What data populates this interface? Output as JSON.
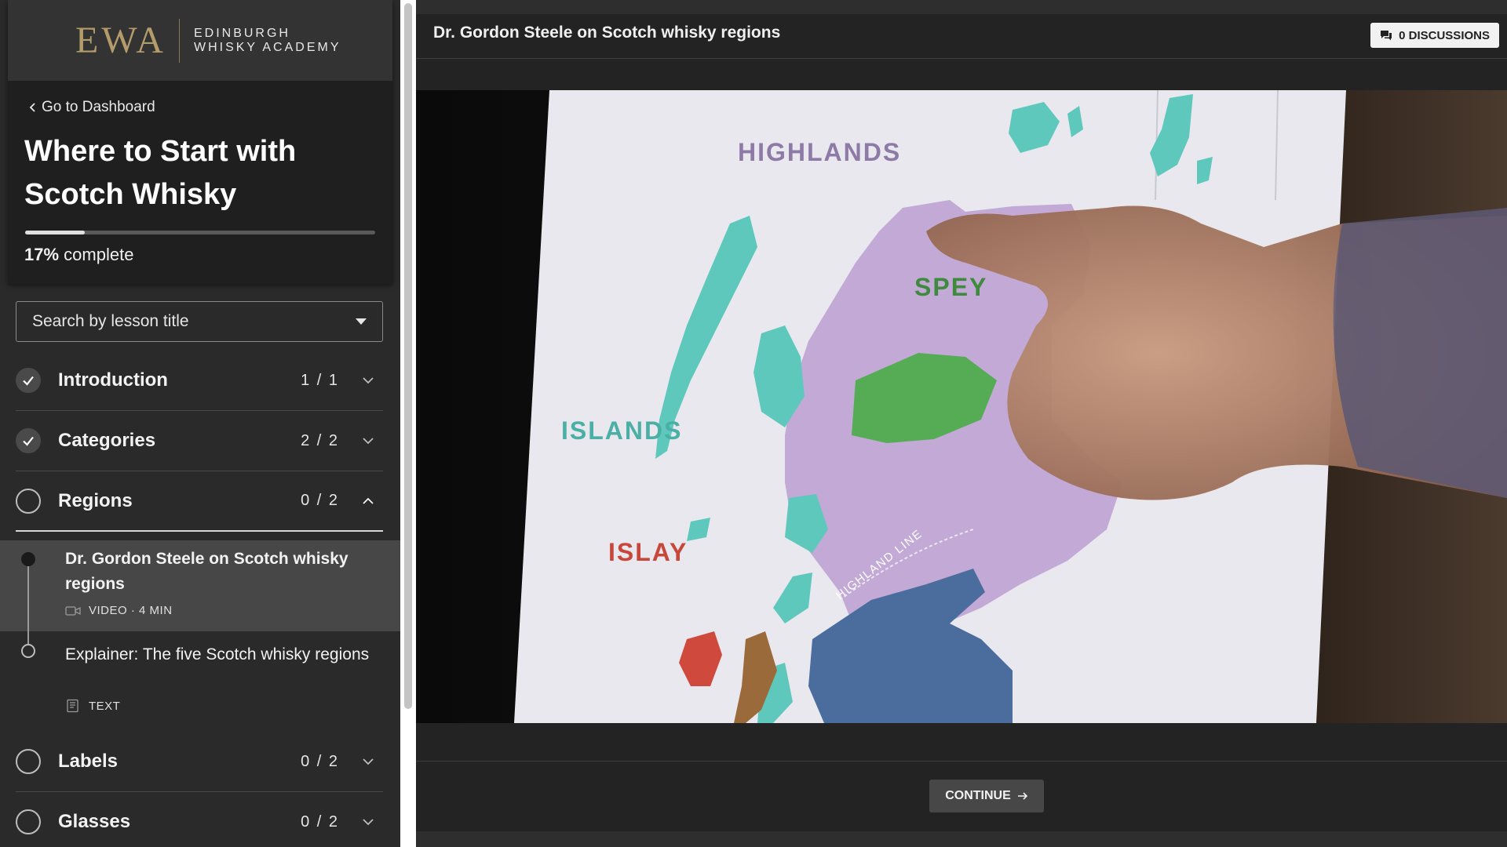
{
  "brand": {
    "logo_mark": "EWA",
    "name_line1": "EDINBURGH",
    "name_line2": "WHISKY ACADEMY",
    "accent_color": "#b39c6a"
  },
  "sidebar": {
    "back_link": "Go to Dashboard",
    "course_title": "Where to Start with Scotch Whisky",
    "progress_percent": 17,
    "progress_value": "17%",
    "progress_suffix": " complete",
    "search_placeholder": "Search by lesson title",
    "sections": [
      {
        "title": "Introduction",
        "count": "1 / 1",
        "status": "complete",
        "icon": "check-icon"
      },
      {
        "title": "Categories",
        "count": "2 / 2",
        "status": "complete",
        "icon": "check-icon"
      },
      {
        "title": "Regions",
        "count": "0 / 2",
        "status": "open"
      },
      {
        "title": "Labels",
        "count": "0 / 2",
        "status": "not-started"
      },
      {
        "title": "Glasses",
        "count": "0 / 2",
        "status": "not-started"
      }
    ],
    "lessons": [
      {
        "title": "Dr. Gordon Steele on Scotch whisky regions",
        "type": "VIDEO",
        "separator": " · ",
        "duration": "4 MIN",
        "icon": "video-camera-icon",
        "active": true
      },
      {
        "title": "Explainer: The five Scotch whisky regions",
        "type": "TEXT",
        "icon": "text-document-icon",
        "active": false
      }
    ]
  },
  "main": {
    "lesson_title": "Dr. Gordon Steele on Scotch whisky regions",
    "discussions_label": "0 DISCUSSIONS",
    "continue_label": "CONTINUE",
    "video": {
      "map_labels": {
        "highlands": "HIGHLANDS",
        "speyside": "SPEY",
        "islands": "ISLANDS",
        "islay": "ISLAY",
        "highland_line": "HIGHLAND LINE"
      },
      "colors": {
        "highlands": "#c3a9d6",
        "speyside": "#56ac55",
        "islands": "#5ec8bd",
        "islay": "#cf4a3c",
        "campbeltown": "#9a6a3a",
        "lowlands": "#4a6d9e"
      }
    }
  }
}
